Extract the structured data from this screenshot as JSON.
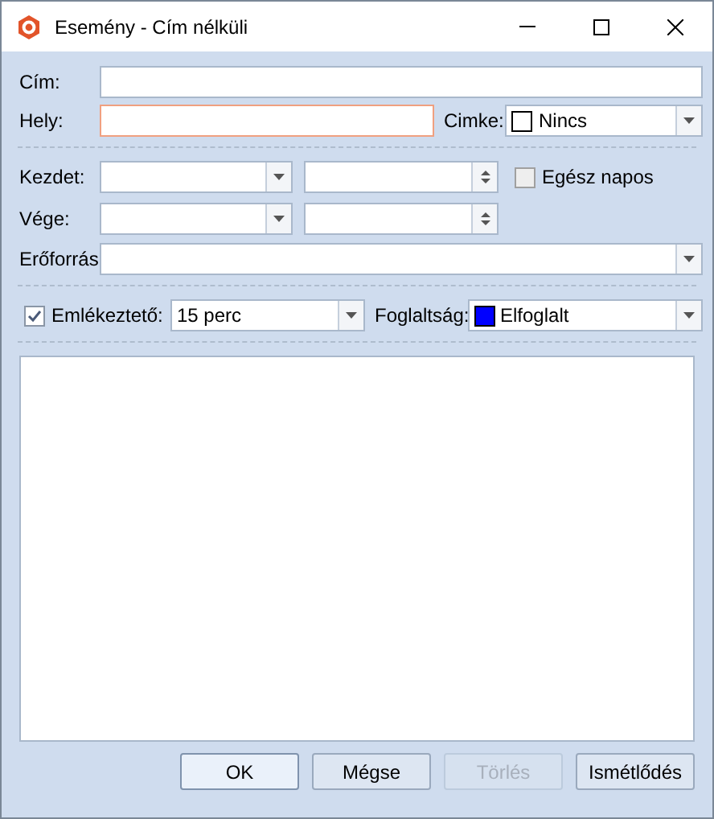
{
  "window": {
    "title": "Esemény - Cím nélküli"
  },
  "subject": {
    "label": "Cím:"
  },
  "location": {
    "label": "Hely:",
    "error": true
  },
  "label_field": {
    "label": "Cimke:",
    "value": "Nincs",
    "color": "#ffffff"
  },
  "start": {
    "label": "Kezdet:"
  },
  "end": {
    "label": "Vége:"
  },
  "all_day": {
    "label": "Egész napos",
    "checked": false
  },
  "resource": {
    "label": "Erőforrás"
  },
  "reminder": {
    "label": "Emlékeztető:",
    "checked": true,
    "value": "15 perc"
  },
  "busy": {
    "label": "Foglaltság:",
    "value": "Elfoglalt",
    "color": "#0000ff"
  },
  "buttons": [
    {
      "label": "OK",
      "disabled": false,
      "default": true
    },
    {
      "label": "Mégse",
      "disabled": false,
      "default": false
    },
    {
      "label": "Törlés",
      "disabled": true,
      "default": false
    },
    {
      "label": "Ismétlődés",
      "disabled": false,
      "default": false
    }
  ]
}
